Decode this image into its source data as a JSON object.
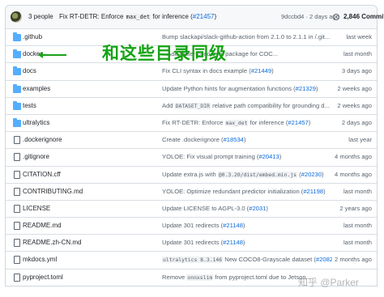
{
  "commit_bar": {
    "people": "3 people",
    "message_prefix": "Fix RT-DETR: Enforce",
    "message_code": "max_det",
    "message_suffix": "for inference (",
    "message_link": "#21457",
    "message_end": ")",
    "hash_age": "9dccbd4 · 2 days ago",
    "commits_count": "2,846 Commits"
  },
  "annotation": {
    "label": "和这些目录同级"
  },
  "watermark": "知乎 @Parker",
  "rows": [
    {
      "name": ".github",
      "kind": "folder",
      "msg_pre": "Bump slackapi/slack-github-action from 2.1.0 to 2.1.1 in /.git...",
      "code": "",
      "msg_mid": "",
      "link": "",
      "msg_post": "",
      "age": "last week"
    },
    {
      "name": "docker",
      "kind": "folder",
      "msg_pre": "...",
      "code": "",
      "msg_mid": "Add faster-coco-eval package for COC...",
      "link": "",
      "msg_post": "",
      "age": "last month"
    },
    {
      "name": "docs",
      "kind": "folder",
      "msg_pre": "Fix CLI syntax in docs example (",
      "code": "",
      "msg_mid": "",
      "link": "#21449",
      "msg_post": ")",
      "age": "3 days ago"
    },
    {
      "name": "examples",
      "kind": "folder",
      "msg_pre": "Update Python hints for augmentation functions (",
      "code": "",
      "msg_mid": "",
      "link": "#21329",
      "msg_post": ")",
      "age": "2 weeks ago"
    },
    {
      "name": "tests",
      "kind": "folder",
      "msg_pre": "Add ",
      "code": "DATASET_DIR",
      "msg_mid": " relative path compatibility for grounding d...",
      "link": "",
      "msg_post": "",
      "age": "2 weeks ago"
    },
    {
      "name": "ultralytics",
      "kind": "folder",
      "msg_pre": "Fix RT-DETR: Enforce ",
      "code": "max_det",
      "msg_mid": " for inference (",
      "link": "#21457",
      "msg_post": ")",
      "age": "2 days ago"
    },
    {
      "name": ".dockerignore",
      "kind": "file",
      "msg_pre": "Create ",
      "code": "",
      "msg_mid": ".dockerignore (",
      "link": "#18534",
      "msg_post": ")",
      "age": "last year"
    },
    {
      "name": ".gitignore",
      "kind": "file",
      "msg_pre": "YOLOE: Fix visual prompt training (",
      "code": "",
      "msg_mid": "",
      "link": "#20413",
      "msg_post": ")",
      "age": "4 months ago"
    },
    {
      "name": "CITATION.cff",
      "kind": "file",
      "msg_pre": "Update extra.js with ",
      "code": "@0.3.20/dist/embed.min.js",
      "msg_mid": " (",
      "link": "#20230",
      "msg_post": ")",
      "age": "4 months ago"
    },
    {
      "name": "CONTRIBUTING.md",
      "kind": "file",
      "msg_pre": "YOLOE: Optimize redundant predictor initialization (",
      "code": "",
      "msg_mid": "",
      "link": "#21198",
      "msg_post": ")",
      "age": "last month"
    },
    {
      "name": "LICENSE",
      "kind": "file",
      "msg_pre": "Update LICENSE to AGPL-3.0 (",
      "code": "",
      "msg_mid": "",
      "link": "#2031",
      "msg_post": ")",
      "age": "2 years ago"
    },
    {
      "name": "README.md",
      "kind": "file",
      "msg_pre": "Update 301 redirects (",
      "code": "",
      "msg_mid": "",
      "link": "#21148",
      "msg_post": ")",
      "age": "last month"
    },
    {
      "name": "README.zh-CN.md",
      "kind": "file",
      "msg_pre": "Update 301 redirects (",
      "code": "",
      "msg_mid": "",
      "link": "#21148",
      "msg_post": ")",
      "age": "last month"
    },
    {
      "name": "mkdocs.yml",
      "kind": "file",
      "msg_pre": "",
      "code": "ultralytics 8.3.146",
      "msg_mid": " New COCO8-Grayscale dataset (",
      "link": "#20827",
      "msg_post": ")",
      "age": "2 months ago"
    },
    {
      "name": "pyproject.toml",
      "kind": "file",
      "msg_pre": "Remove ",
      "code": "onnxslim",
      "msg_mid": " from ",
      "link": "",
      "msg_post": "pyproject.toml due to Jetson...",
      "age": ""
    }
  ]
}
